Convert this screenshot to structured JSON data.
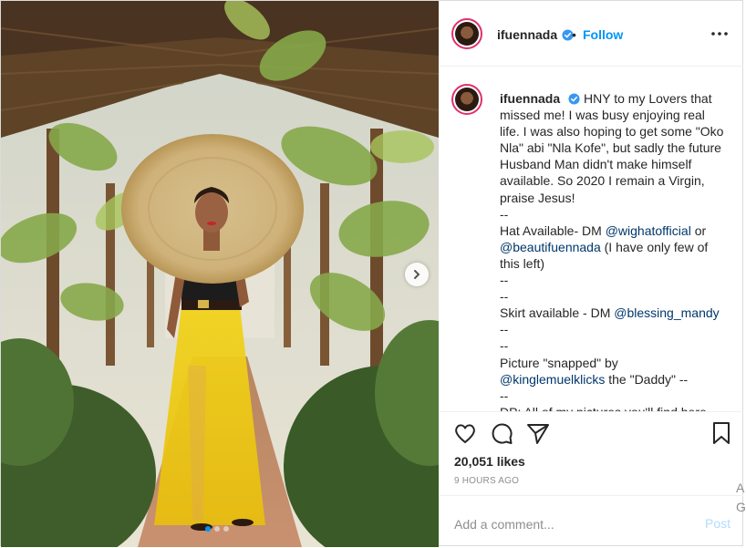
{
  "colors": {
    "link_blue": "#0095f6",
    "mention_blue": "#00376b",
    "text": "#262626",
    "muted": "#8e8e8e",
    "story_ring": "#e1306c",
    "post_disabled": "#b3dbff"
  },
  "header": {
    "username": "ifuennada",
    "bullet": "•",
    "follow_label": "Follow",
    "more_icon": "more-horizontal-icon",
    "verified_icon": "verified-badge-icon"
  },
  "caption": {
    "username": "ifuennada",
    "lines": [
      {
        "text": "HNY to my Lovers that missed me! I was busy enjoying real life. I was also hoping to get some \"Oko Nla\" abi \"Nla Kofe\", but sadly the future Husband Man didn't make himself available. So 2020 I remain a Virgin, praise Jesus!"
      },
      {
        "text": "--"
      },
      {
        "pre": "Hat Available- DM ",
        "mention": "@wighatofficial",
        "post": " or"
      },
      {
        "pre": "",
        "mention": "@beautifuennada",
        "post": " (I have only few of this left)"
      },
      {
        "text": "--"
      },
      {
        "text": "--"
      },
      {
        "pre": "Skirt available - DM ",
        "mention": "@blessing_mandy",
        "post": ""
      },
      {
        "text": "--"
      },
      {
        "text": "--"
      },
      {
        "text": "Picture \"snapped\" by"
      },
      {
        "pre": "",
        "mention": "@kinglemuelklicks",
        "post": " the \"Daddy\" --"
      },
      {
        "text": "--"
      },
      {
        "text": "DP: All of my pictures you'll find here"
      }
    ]
  },
  "actions": {
    "like_icon": "heart-icon",
    "comment_icon": "comment-icon",
    "share_icon": "paper-plane-icon",
    "save_icon": "bookmark-icon",
    "likes": "20,051 likes",
    "time": "9 HOURS AGO"
  },
  "comment": {
    "placeholder": "Add a comment...",
    "post_label": "Post"
  },
  "carousel": {
    "next_icon": "chevron-right-icon",
    "slide_count": 3,
    "active_slide": 1
  },
  "edge_text": {
    "a": "A",
    "g": "G"
  }
}
